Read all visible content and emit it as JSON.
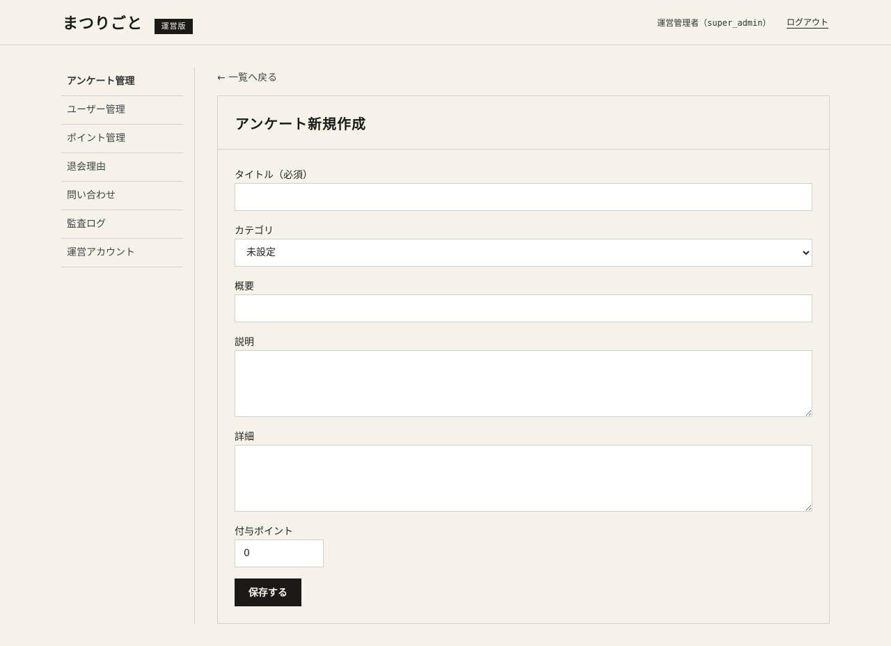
{
  "header": {
    "logo": "まつりごと",
    "badge": "運営版",
    "user": "運営管理者（super_admin）",
    "logout": "ログアウト"
  },
  "sidebar": {
    "items": [
      {
        "label": "アンケート管理",
        "active": true
      },
      {
        "label": "ユーザー管理"
      },
      {
        "label": "ポイント管理"
      },
      {
        "label": "退会理由"
      },
      {
        "label": "問い合わせ"
      },
      {
        "label": "監査ログ"
      },
      {
        "label": "運営アカウント"
      }
    ]
  },
  "back_link": "← 一覧へ戻る",
  "form": {
    "title": "アンケート新規作成",
    "fields": {
      "title_label": "タイトル（必須）",
      "title_value": "",
      "category_label": "カテゴリ",
      "category_value": "未設定",
      "summary_label": "概要",
      "summary_value": "",
      "description_label": "説明",
      "description_value": "",
      "detail_label": "詳細",
      "detail_value": "",
      "points_label": "付与ポイント",
      "points_value": "0"
    },
    "save_label": "保存する"
  }
}
